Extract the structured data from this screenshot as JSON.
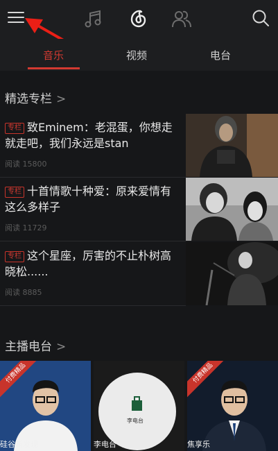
{
  "tabs": [
    {
      "label": "音乐",
      "active": true
    },
    {
      "label": "视频",
      "active": false
    },
    {
      "label": "电台",
      "active": false
    }
  ],
  "featured": {
    "title": "精选专栏",
    "chevron": ">",
    "articles": [
      {
        "badge": "专栏",
        "title": "致Eminem：老混蛋，你想走就走吧，我们永远是stan",
        "reads": "阅读 15800"
      },
      {
        "badge": "专栏",
        "title": "十首情歌十种爱：原来爱情有这么多样子",
        "reads": "阅读 11729"
      },
      {
        "badge": "专栏",
        "title": "这个星座，厉害的不止朴树高晓松......",
        "reads": "阅读 8885"
      }
    ]
  },
  "radio": {
    "title": "主播电台",
    "chevron": ">",
    "cards": [
      {
        "name": "硅谷新发现",
        "ribbon": "付费精品"
      },
      {
        "name": "李电台",
        "logo_text": "李电台"
      },
      {
        "name": "焦享乐",
        "ribbon": "付费精品"
      }
    ]
  },
  "icons": [
    "menu-icon",
    "music-note-icon",
    "netease-logo-icon",
    "friends-icon",
    "search-icon"
  ],
  "colors": {
    "accent": "#d33a31",
    "background": "#161719",
    "bar": "#1d1e20"
  }
}
